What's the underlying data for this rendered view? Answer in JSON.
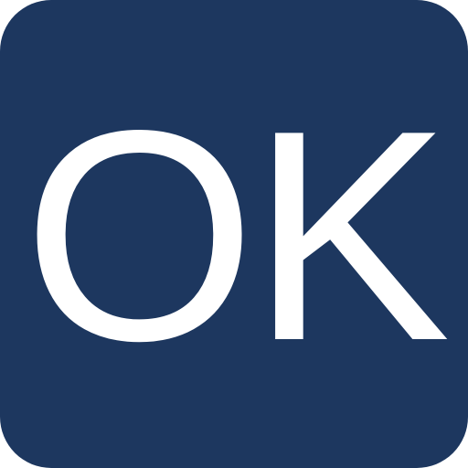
{
  "button": {
    "label": "OK",
    "background_color": "#1d375f",
    "text_color": "#ffffff"
  }
}
